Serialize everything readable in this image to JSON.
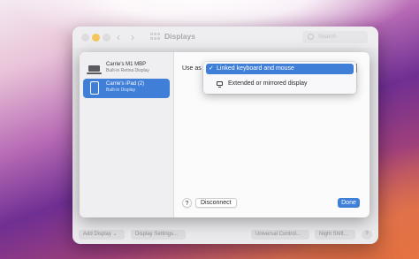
{
  "window": {
    "title": "Displays",
    "search_placeholder": "Search",
    "nav_back": "‹",
    "nav_forward": "›"
  },
  "bottom_bar": {
    "add_display": "Add Display ⌄",
    "display_settings": "Display Settings...",
    "universal_control": "Universal Control...",
    "night_shift": "Night Shift...",
    "help": "?"
  },
  "sheet": {
    "devices": [
      {
        "name": "Carrie's M1 MBP",
        "subtitle": "Built-in Retina Display",
        "icon": "laptop-icon",
        "selected": false
      },
      {
        "name": "Carrie's iPad (2)",
        "subtitle": "Built-in Display",
        "icon": "ipad-icon",
        "selected": true
      }
    ],
    "use_as_label": "Use as",
    "menu": {
      "options": [
        {
          "label": "Linked keyboard and mouse",
          "checked": true,
          "check": "✓"
        },
        {
          "label": "Extended or mirrored display",
          "checked": false,
          "icon": "monitor-icon"
        }
      ]
    },
    "help": "?",
    "disconnect": "Disconnect",
    "done": "Done"
  },
  "colors": {
    "accent": "#3f7fd8",
    "window_bg": "#e7e6e9",
    "sheet_bg": "#fbfbfc"
  }
}
